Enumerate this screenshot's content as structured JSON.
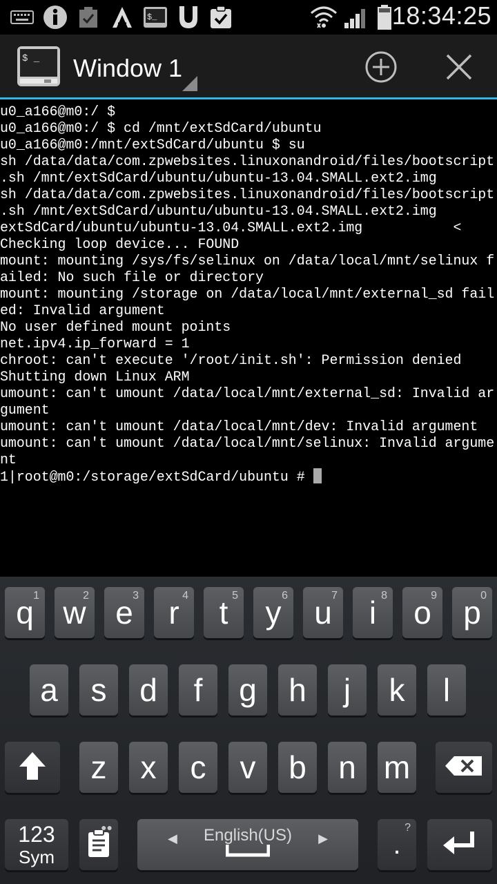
{
  "status_bar": {
    "time": "18:34:25",
    "icons": [
      "keyboard-icon",
      "info-icon",
      "task-check-icon",
      "aurora-icon",
      "terminal-notification-icon",
      "shield-icon",
      "clipboard-check-icon",
      "wifi-icon",
      "signal-icon",
      "battery-icon"
    ]
  },
  "action_bar": {
    "title": "Window 1",
    "add_label": "+",
    "close_label": "✕",
    "icons": [
      "terminal-app-icon",
      "add-window-icon",
      "close-window-icon"
    ]
  },
  "terminal": {
    "lines": [
      "u0_a166@m0:/ $",
      "u0_a166@m0:/ $ cd /mnt/extSdCard/ubuntu",
      "u0_a166@m0:/mnt/extSdCard/ubuntu $ su",
      "sh /data/data/com.zpwebsites.linuxonandroid/files/bootscript",
      ".sh /mnt/extSdCard/ubuntu/ubuntu-13.04.SMALL.ext2.img",
      "sh /data/data/com.zpwebsites.linuxonandroid/files/bootscript",
      ".sh /mnt/extSdCard/ubuntu/ubuntu-13.04.SMALL.ext2.img",
      "extSdCard/ubuntu/ubuntu-13.04.SMALL.ext2.img           <",
      "Checking loop device... FOUND",
      "mount: mounting /sys/fs/selinux on /data/local/mnt/selinux f",
      "ailed: No such file or directory",
      "mount: mounting /storage on /data/local/mnt/external_sd fail",
      "ed: Invalid argument",
      "No user defined mount points",
      "net.ipv4.ip_forward = 1",
      "chroot: can't execute '/root/init.sh': Permission denied",
      "Shutting down Linux ARM",
      "umount: can't umount /data/local/mnt/external_sd: Invalid ar",
      "gument",
      "umount: can't umount /data/local/mnt/dev: Invalid argument",
      "umount: can't umount /data/local/mnt/selinux: Invalid argume",
      "nt"
    ],
    "prompt": "1|root@m0:/storage/extSdCard/ubuntu # "
  },
  "keyboard": {
    "row1": [
      {
        "label": "q",
        "hint": "1"
      },
      {
        "label": "w",
        "hint": "2"
      },
      {
        "label": "e",
        "hint": "3"
      },
      {
        "label": "r",
        "hint": "4"
      },
      {
        "label": "t",
        "hint": "5"
      },
      {
        "label": "y",
        "hint": "6"
      },
      {
        "label": "u",
        "hint": "7"
      },
      {
        "label": "i",
        "hint": "8"
      },
      {
        "label": "o",
        "hint": "9"
      },
      {
        "label": "p",
        "hint": "0"
      }
    ],
    "row2": [
      "a",
      "s",
      "d",
      "f",
      "g",
      "h",
      "j",
      "k",
      "l"
    ],
    "row3": [
      "z",
      "x",
      "c",
      "v",
      "b",
      "n",
      "m"
    ],
    "sym_line1": "123",
    "sym_line2": "Sym",
    "language": "English(US)",
    "period": ".",
    "period_hint": "?",
    "icons": [
      "shift-icon",
      "backspace-icon",
      "clipboard-icon",
      "enter-icon"
    ]
  }
}
